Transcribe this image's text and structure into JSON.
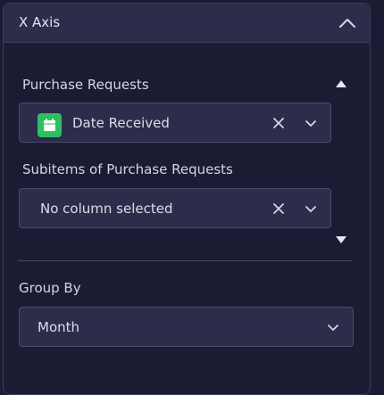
{
  "header": {
    "title": "X Axis",
    "collapse_icon": "chevron-up-icon"
  },
  "purchase_requests": {
    "label": "Purchase Requests",
    "selected_value": "Date Received",
    "icon": "calendar-icon",
    "icon_color": "#2ebf5e"
  },
  "subitems": {
    "label": "Subitems of Purchase Requests",
    "selected_value": "No column selected"
  },
  "group_by": {
    "label": "Group By",
    "selected_value": "Month"
  },
  "colors": {
    "background": "#1b1c33",
    "header_bg": "#2c2d4a",
    "input_bg": "#2c2d4a",
    "border": "#4a4b6a",
    "text": "#d4d5e6"
  }
}
